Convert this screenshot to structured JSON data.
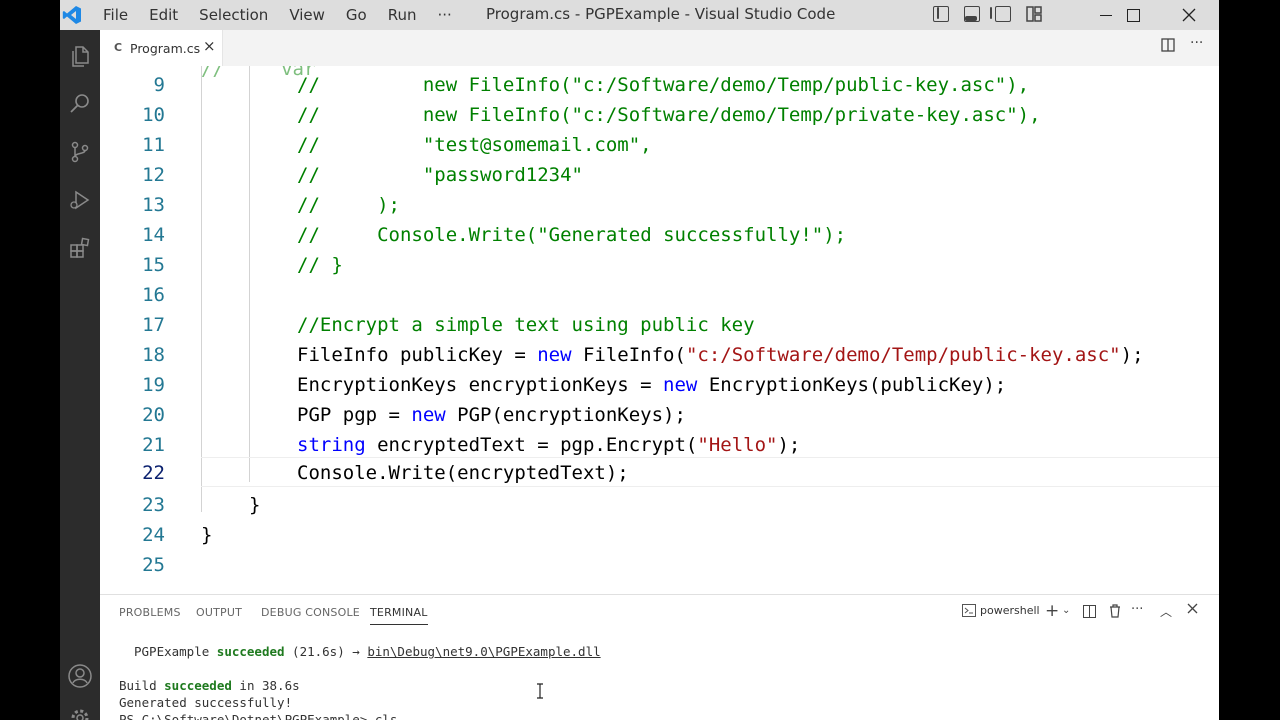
{
  "window": {
    "title": "Program.cs - PGPExample - Visual Studio Code"
  },
  "menu": {
    "items": [
      "File",
      "Edit",
      "Selection",
      "View",
      "Go",
      "Run",
      "···"
    ]
  },
  "tab": {
    "file_icon": "C",
    "label": "Program.cs",
    "close": "×"
  },
  "editor": {
    "lines": [
      9,
      10,
      11,
      12,
      13,
      14,
      15,
      16,
      17,
      18,
      19,
      20,
      21,
      22,
      23,
      24,
      25
    ],
    "current_line": 22
  },
  "code": {
    "l9": {
      "c": "//",
      "s": "new FileInfo(\"c:/Software/demo/Temp/public-key.asc\"),",
      "pad": "         "
    },
    "l10": {
      "c": "//",
      "s": "new FileInfo(\"c:/Software/demo/Temp/private-key.asc\"),",
      "pad": "         "
    },
    "l11": {
      "c": "//",
      "s": "\"test@somemail.com\",",
      "pad": "         "
    },
    "l12": {
      "c": "//",
      "s": "\"password1234\"",
      "pad": "         "
    },
    "l13": {
      "c": "//",
      "s": ");",
      "pad": "     "
    },
    "l14": {
      "c": "//",
      "s": "Console.Write(\"Generated successfully!\");",
      "pad": "     "
    },
    "l15": "// }",
    "l17": "//Encrypt a simple text using public key",
    "l18": {
      "a": "FileInfo publicKey = ",
      "kw": "new",
      "b": " FileInfo(",
      "s": "\"c:/Software/demo/Temp/public-key.asc\"",
      "e": ");"
    },
    "l19": {
      "a": "EncryptionKeys encryptionKeys = ",
      "kw": "new",
      "b": " EncryptionKeys(publicKey);"
    },
    "l20": {
      "a": "PGP pgp = ",
      "kw": "new",
      "b": " PGP(encryptionKeys);"
    },
    "l21": {
      "kw": "string",
      "a": " encryptedText = pgp.Encrypt(",
      "s": "\"Hello\"",
      "e": ");"
    },
    "l22": "Console.Write(encryptedText);",
    "l23": "}",
    "l24": "}"
  },
  "panel": {
    "tabs": [
      "PROBLEMS",
      "OUTPUT",
      "DEBUG CONSOLE",
      "TERMINAL"
    ],
    "active_tab": "TERMINAL",
    "shell_label": "powershell",
    "terminal": {
      "line1": {
        "a": "PGPExample ",
        "ok": "succeeded",
        "b": " (21.6s) → ",
        "link": "bin\\Debug\\net9.0\\PGPExample.dll"
      },
      "line2": {
        "a": "Build ",
        "ok": "succeeded",
        "b": " in 38.6s"
      },
      "line3": "Generated successfully!",
      "line4": "PS C:\\Software\\Dotnet\\PGPExample> cls"
    }
  },
  "colors": {
    "comment": "#008000",
    "string": "#a31515",
    "keyword": "#0000ff",
    "line_number": "#237893",
    "activity_bar": "#2c2c2c",
    "title_bar": "#dddddd"
  }
}
